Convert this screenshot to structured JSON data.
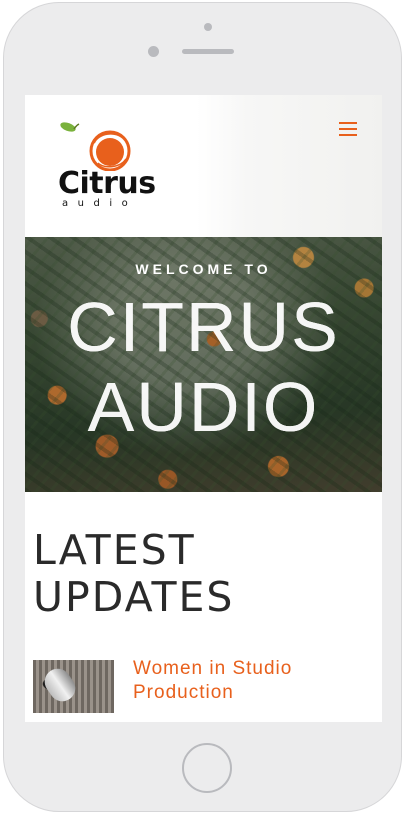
{
  "site": {
    "logo_text": "Citrus",
    "logo_sub": "audio",
    "menu_icon": "hamburger-icon",
    "accent_color": "#e8601c"
  },
  "hero": {
    "welcome": "WELCOME TO",
    "title_line1": "CITRUS",
    "title_line2": "AUDIO"
  },
  "section": {
    "heading_line1": "LATEST",
    "heading_line2": "UPDATES"
  },
  "posts": [
    {
      "title": "Women in Studio Production",
      "excerpt": "..."
    }
  ]
}
